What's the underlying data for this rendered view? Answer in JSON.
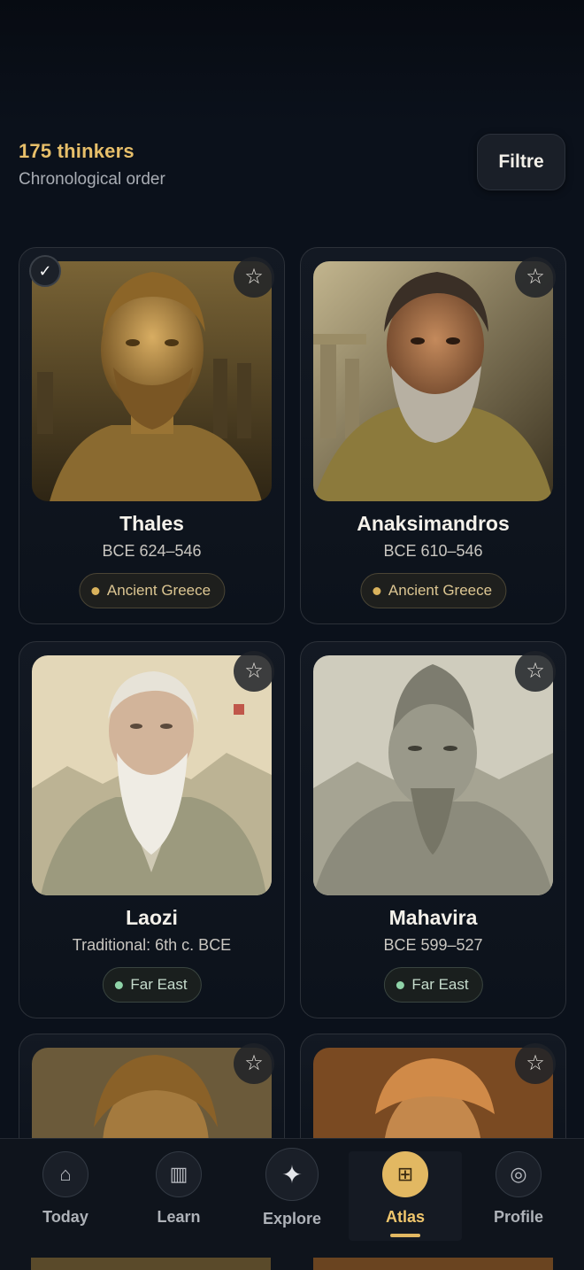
{
  "header": {
    "count_label": "175 thinkers",
    "order_label": "Chronological order",
    "filter_label": "Filtre"
  },
  "cards": [
    {
      "name": "Thales",
      "dates": "BCE 624–546",
      "region": "Ancient Greece",
      "checked": true
    },
    {
      "name": "Anaksimandros",
      "dates": "BCE 610–546",
      "region": "Ancient Greece",
      "checked": false
    },
    {
      "name": "Laozi",
      "dates": "Traditional: 6th c. BCE",
      "region": "Far East",
      "checked": false
    },
    {
      "name": "Mahavira",
      "dates": "BCE 599–527",
      "region": "Far East",
      "checked": false
    }
  ],
  "icons": {
    "star": "☆",
    "check": "✓",
    "today": "⌂",
    "learn": "▥",
    "explore": "✦",
    "atlas": "⊞",
    "profile": "◎"
  },
  "nav": {
    "items": [
      {
        "label": "Today",
        "icon": "home-icon"
      },
      {
        "label": "Learn",
        "icon": "library-icon"
      },
      {
        "label": "Explore",
        "icon": "sparkle-icon"
      },
      {
        "label": "Atlas",
        "icon": "grid-icon"
      },
      {
        "label": "Profile",
        "icon": "profile-icon"
      }
    ],
    "active": "Atlas"
  },
  "colors": {
    "accent": "#e7bf6a",
    "background": "#0b111b",
    "greece_dot": "#d9b25c",
    "east_dot": "#8fd3a8"
  }
}
